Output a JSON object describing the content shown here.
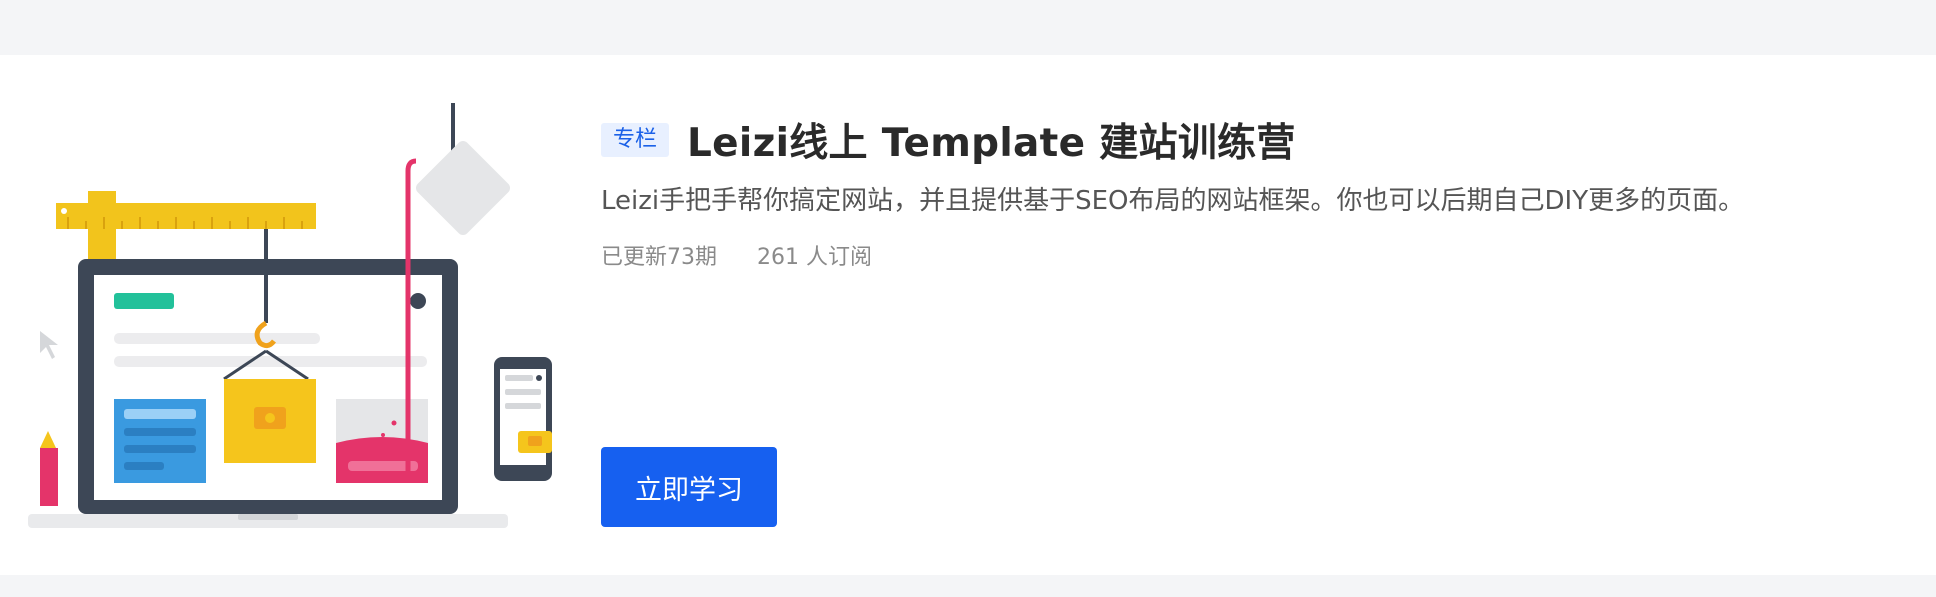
{
  "course": {
    "tag": "专栏",
    "title": "Leizi线上 Template 建站训练营",
    "description": "Leizi手把手帮你搞定网站，并且提供基于SEO布局的网站框架。你也可以后期自己DIY更多的页面。",
    "updates": "已更新73期",
    "subscribers": "261 人订阅",
    "cta_label": "立即学习"
  },
  "colors": {
    "accent": "#1660f0",
    "tag_bg": "#e8f0ff",
    "tag_text": "#1b61e8",
    "page_bg": "#f4f5f7"
  },
  "illustration": {
    "icon": "website-building-illustration"
  }
}
